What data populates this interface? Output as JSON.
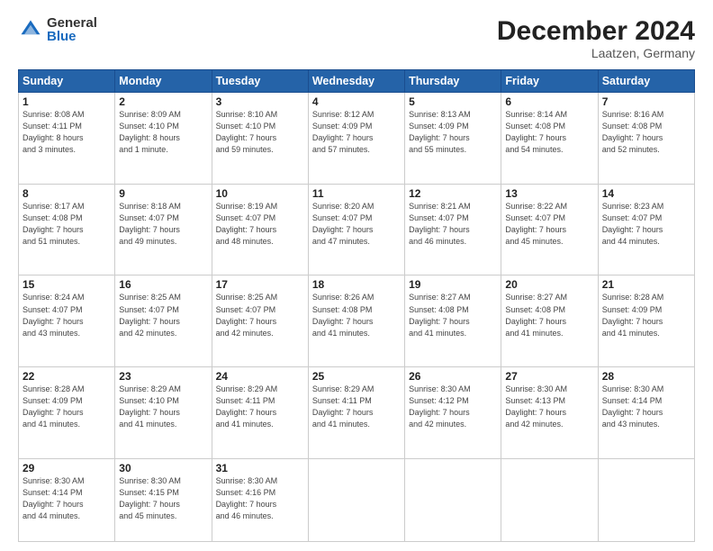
{
  "header": {
    "logo_general": "General",
    "logo_blue": "Blue",
    "title": "December 2024",
    "subtitle": "Laatzen, Germany"
  },
  "columns": [
    "Sunday",
    "Monday",
    "Tuesday",
    "Wednesday",
    "Thursday",
    "Friday",
    "Saturday"
  ],
  "weeks": [
    [
      {
        "day": "1",
        "info": "Sunrise: 8:08 AM\nSunset: 4:11 PM\nDaylight: 8 hours\nand 3 minutes."
      },
      {
        "day": "2",
        "info": "Sunrise: 8:09 AM\nSunset: 4:10 PM\nDaylight: 8 hours\nand 1 minute."
      },
      {
        "day": "3",
        "info": "Sunrise: 8:10 AM\nSunset: 4:10 PM\nDaylight: 7 hours\nand 59 minutes."
      },
      {
        "day": "4",
        "info": "Sunrise: 8:12 AM\nSunset: 4:09 PM\nDaylight: 7 hours\nand 57 minutes."
      },
      {
        "day": "5",
        "info": "Sunrise: 8:13 AM\nSunset: 4:09 PM\nDaylight: 7 hours\nand 55 minutes."
      },
      {
        "day": "6",
        "info": "Sunrise: 8:14 AM\nSunset: 4:08 PM\nDaylight: 7 hours\nand 54 minutes."
      },
      {
        "day": "7",
        "info": "Sunrise: 8:16 AM\nSunset: 4:08 PM\nDaylight: 7 hours\nand 52 minutes."
      }
    ],
    [
      {
        "day": "8",
        "info": "Sunrise: 8:17 AM\nSunset: 4:08 PM\nDaylight: 7 hours\nand 51 minutes."
      },
      {
        "day": "9",
        "info": "Sunrise: 8:18 AM\nSunset: 4:07 PM\nDaylight: 7 hours\nand 49 minutes."
      },
      {
        "day": "10",
        "info": "Sunrise: 8:19 AM\nSunset: 4:07 PM\nDaylight: 7 hours\nand 48 minutes."
      },
      {
        "day": "11",
        "info": "Sunrise: 8:20 AM\nSunset: 4:07 PM\nDaylight: 7 hours\nand 47 minutes."
      },
      {
        "day": "12",
        "info": "Sunrise: 8:21 AM\nSunset: 4:07 PM\nDaylight: 7 hours\nand 46 minutes."
      },
      {
        "day": "13",
        "info": "Sunrise: 8:22 AM\nSunset: 4:07 PM\nDaylight: 7 hours\nand 45 minutes."
      },
      {
        "day": "14",
        "info": "Sunrise: 8:23 AM\nSunset: 4:07 PM\nDaylight: 7 hours\nand 44 minutes."
      }
    ],
    [
      {
        "day": "15",
        "info": "Sunrise: 8:24 AM\nSunset: 4:07 PM\nDaylight: 7 hours\nand 43 minutes."
      },
      {
        "day": "16",
        "info": "Sunrise: 8:25 AM\nSunset: 4:07 PM\nDaylight: 7 hours\nand 42 minutes."
      },
      {
        "day": "17",
        "info": "Sunrise: 8:25 AM\nSunset: 4:07 PM\nDaylight: 7 hours\nand 42 minutes."
      },
      {
        "day": "18",
        "info": "Sunrise: 8:26 AM\nSunset: 4:08 PM\nDaylight: 7 hours\nand 41 minutes."
      },
      {
        "day": "19",
        "info": "Sunrise: 8:27 AM\nSunset: 4:08 PM\nDaylight: 7 hours\nand 41 minutes."
      },
      {
        "day": "20",
        "info": "Sunrise: 8:27 AM\nSunset: 4:08 PM\nDaylight: 7 hours\nand 41 minutes."
      },
      {
        "day": "21",
        "info": "Sunrise: 8:28 AM\nSunset: 4:09 PM\nDaylight: 7 hours\nand 41 minutes."
      }
    ],
    [
      {
        "day": "22",
        "info": "Sunrise: 8:28 AM\nSunset: 4:09 PM\nDaylight: 7 hours\nand 41 minutes."
      },
      {
        "day": "23",
        "info": "Sunrise: 8:29 AM\nSunset: 4:10 PM\nDaylight: 7 hours\nand 41 minutes."
      },
      {
        "day": "24",
        "info": "Sunrise: 8:29 AM\nSunset: 4:11 PM\nDaylight: 7 hours\nand 41 minutes."
      },
      {
        "day": "25",
        "info": "Sunrise: 8:29 AM\nSunset: 4:11 PM\nDaylight: 7 hours\nand 41 minutes."
      },
      {
        "day": "26",
        "info": "Sunrise: 8:30 AM\nSunset: 4:12 PM\nDaylight: 7 hours\nand 42 minutes."
      },
      {
        "day": "27",
        "info": "Sunrise: 8:30 AM\nSunset: 4:13 PM\nDaylight: 7 hours\nand 42 minutes."
      },
      {
        "day": "28",
        "info": "Sunrise: 8:30 AM\nSunset: 4:14 PM\nDaylight: 7 hours\nand 43 minutes."
      }
    ],
    [
      {
        "day": "29",
        "info": "Sunrise: 8:30 AM\nSunset: 4:14 PM\nDaylight: 7 hours\nand 44 minutes."
      },
      {
        "day": "30",
        "info": "Sunrise: 8:30 AM\nSunset: 4:15 PM\nDaylight: 7 hours\nand 45 minutes."
      },
      {
        "day": "31",
        "info": "Sunrise: 8:30 AM\nSunset: 4:16 PM\nDaylight: 7 hours\nand 46 minutes."
      },
      null,
      null,
      null,
      null
    ]
  ]
}
